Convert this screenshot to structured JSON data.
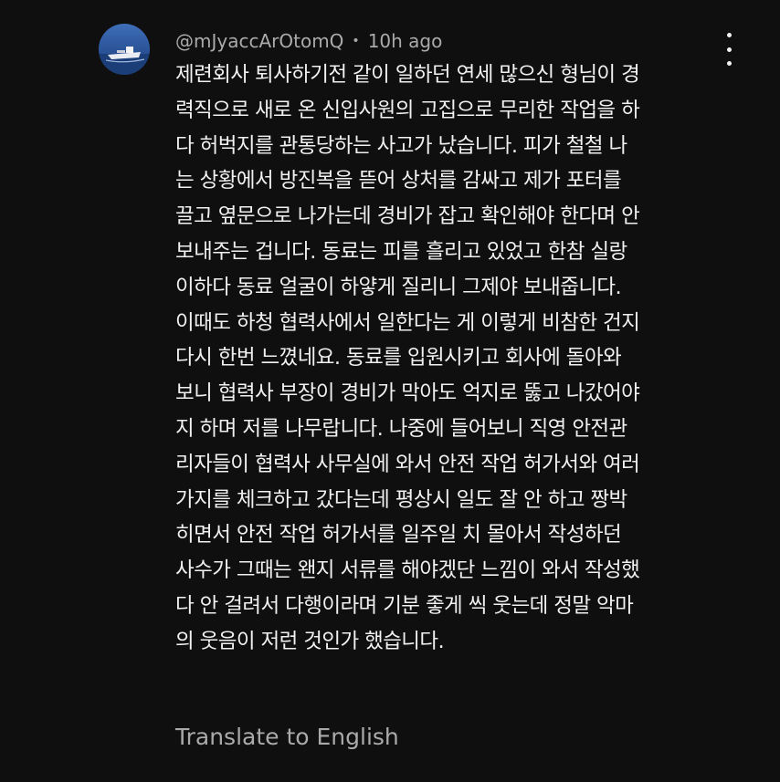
{
  "comment": {
    "author": "@mJyaccArOtomQ",
    "separator": "•",
    "timestamp": "10h ago",
    "lines": [
      "제련회사 퇴사하기전 같이 일하던 연세 많으신 형님이 경",
      "력직으로 새로 온 신입사원의 고집으로 무리한 작업을 하",
      "다 허벅지를 관통당하는 사고가 났습니다. 피가 철철 나",
      "는 상황에서 방진복을 뜯어 상처를 감싸고 제가 포터를",
      "끌고 옆문으로 나가는데 경비가 잡고 확인해야 한다며 안",
      "보내주는 겁니다. 동료는 피를 흘리고 있었고 한참 실랑",
      "이하다 동료 얼굴이 하얗게 질리니 그제야 보내줍니다.",
      "이때도 하청 협력사에서 일한다는 게 이렇게 비참한 건지",
      "다시 한번 느꼈네요. 동료를 입원시키고 회사에 돌아와",
      "보니 협력사 부장이 경비가 막아도 억지로 뚫고 나갔어야",
      "지 하며 저를 나무랍니다. 나중에 들어보니 직영 안전관",
      "리자들이 협력사 사무실에 와서 안전 작업 허가서와 여러",
      "가지를 체크하고 갔다는데 평상시 일도 잘 안 하고 짱박",
      "히면서 안전 작업 허가서를 일주일 치 몰아서 작성하던",
      "사수가 그때는 왠지 서류를 해야겠단 느낌이 와서 작성했",
      "다 안 걸려서 다행이라며 기분 좋게 씩 웃는데 정말 악마",
      "의 웃음이 저런 것인가 했습니다."
    ],
    "translate_label": "Translate to English",
    "more_icon": "vertical-ellipsis-icon",
    "avatar_icon": "ship-avatar"
  }
}
